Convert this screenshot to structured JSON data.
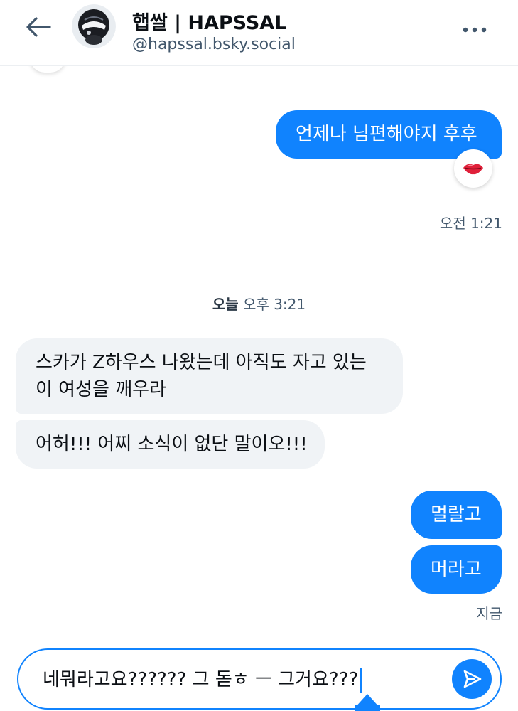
{
  "header": {
    "display_name": "햅쌀 | HAPSSAL",
    "handle": "@hapssal.bsky.social",
    "back_icon": "arrow-left-icon",
    "more_icon": "ellipsis-icon"
  },
  "messages": [
    {
      "side": "mine",
      "text": "언제나 님편해야지 후후",
      "reaction": "👄"
    },
    {
      "side": "mine",
      "timestamp": "오전 1:21"
    },
    {
      "side": "theirs",
      "lines": [
        "스카가 Z하우스 나왔는데 아직도 자고 있는",
        "이 여성을 깨우라"
      ]
    },
    {
      "side": "theirs",
      "text": "어허!!! 어찌 소식이 없단 말이오!!!"
    },
    {
      "side": "mine",
      "text": "멀랄고"
    },
    {
      "side": "mine",
      "text": "머라고"
    }
  ],
  "date_separator": {
    "today": "오늘",
    "time": "오후 3:21"
  },
  "last_timestamp": "지금",
  "composer": {
    "value": "네뭐라고요?????? 그 돋ㅎ ㅡ 그거요???"
  },
  "colors": {
    "accent": "#1083fe",
    "bubble_theirs": "#f0f3f6",
    "muted_text": "#42576c"
  }
}
